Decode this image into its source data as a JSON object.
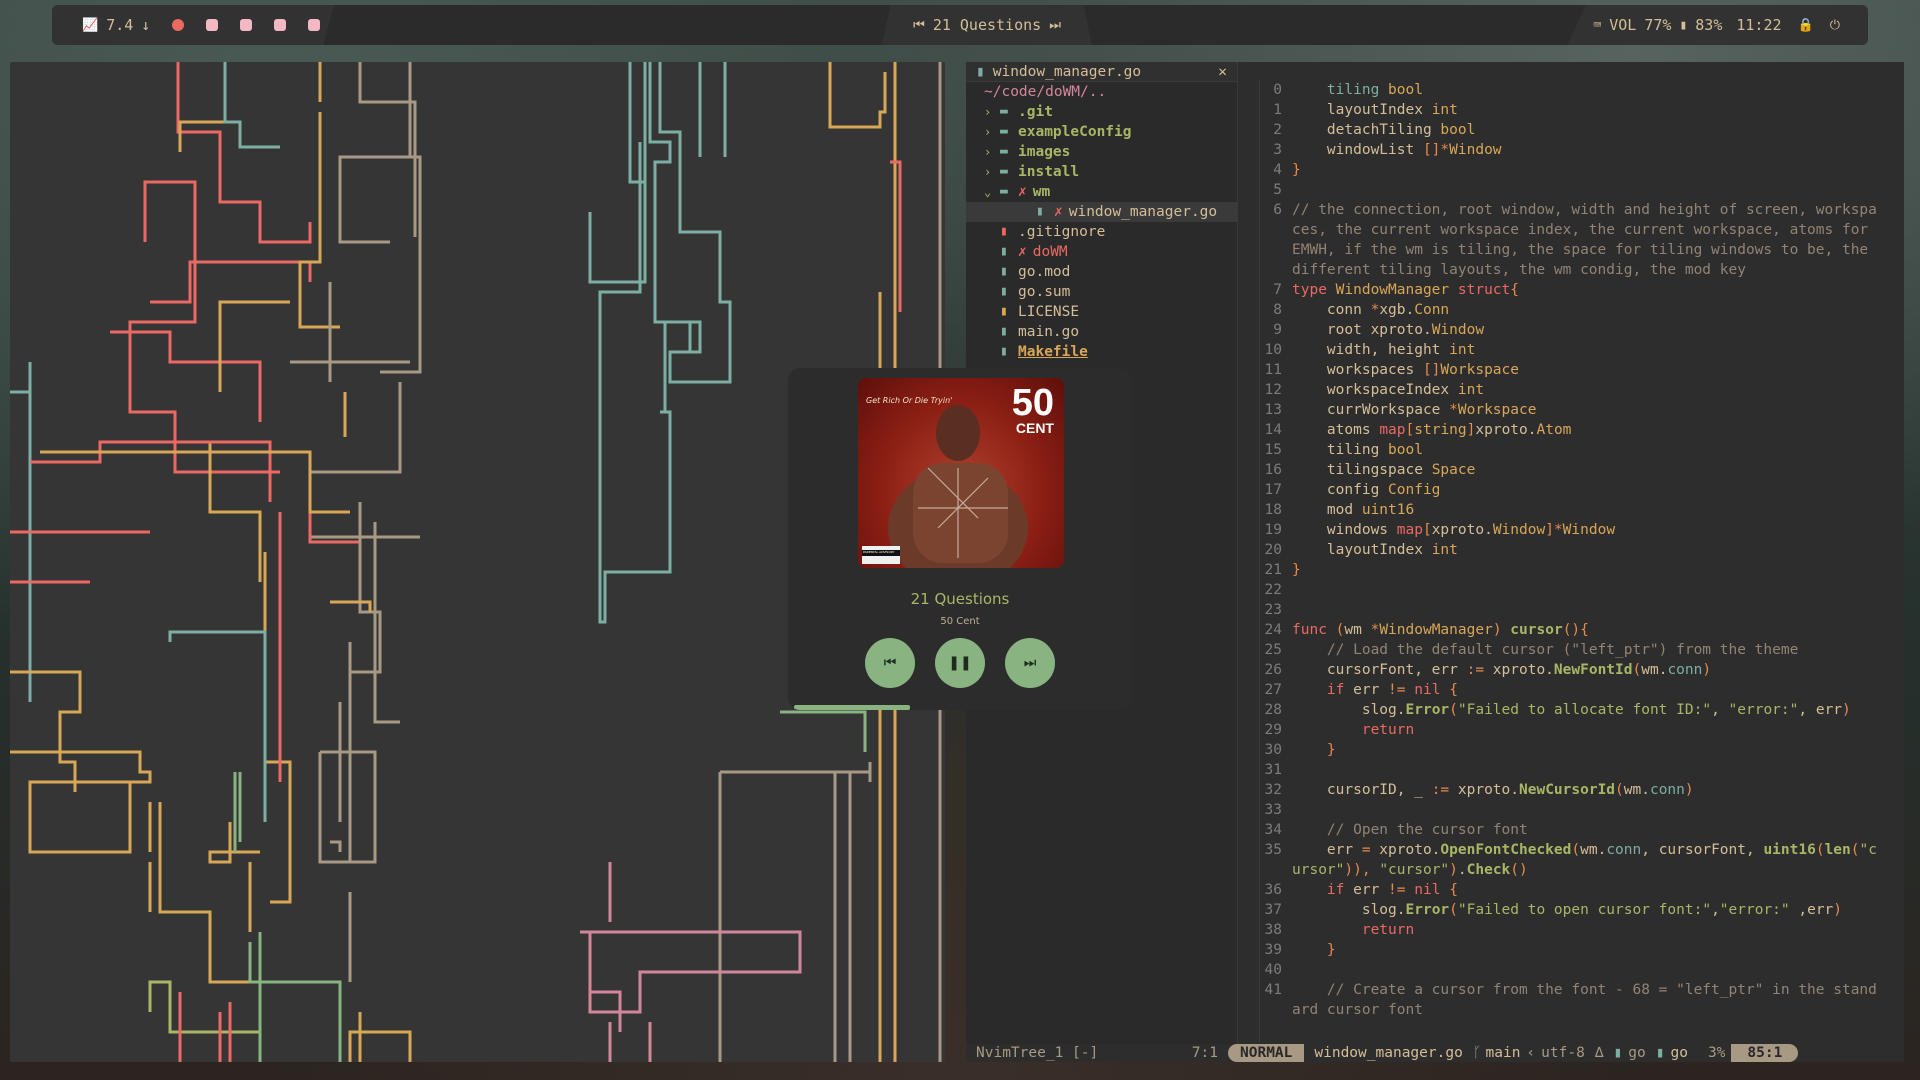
{
  "topbar": {
    "cpu_value": "7.4",
    "cpu_arrow": "↓",
    "track_label": "21 Questions",
    "vol_label": "VOL",
    "vol_value": "77%",
    "battery_value": "83%",
    "clock": "11:22",
    "workspace_count": 5
  },
  "nvim": {
    "tab": {
      "file": "window_manager.go",
      "close": "✕"
    },
    "tree": {
      "root": "~/code/doWM/..",
      "items": [
        {
          "name": ".git",
          "type": "dir",
          "arrow": "›",
          "marker": ""
        },
        {
          "name": "exampleConfig",
          "type": "dir",
          "arrow": "›",
          "marker": ""
        },
        {
          "name": "images",
          "type": "dir",
          "arrow": "›",
          "marker": ""
        },
        {
          "name": "install",
          "type": "dir",
          "arrow": "›",
          "marker": ""
        },
        {
          "name": "wm",
          "type": "dir",
          "arrow": "⌄",
          "marker": "✗"
        },
        {
          "name": "window_manager.go",
          "type": "file",
          "arrow": "",
          "marker": "✗",
          "indent": 1
        },
        {
          "name": ".gitignore",
          "type": "file",
          "arrow": "",
          "marker": ""
        },
        {
          "name": "doWM",
          "type": "file",
          "arrow": "",
          "marker": "✗"
        },
        {
          "name": "go.mod",
          "type": "file",
          "arrow": "",
          "marker": ""
        },
        {
          "name": "go.sum",
          "type": "file",
          "arrow": "",
          "marker": ""
        },
        {
          "name": "LICENSE",
          "type": "file",
          "arrow": "",
          "marker": ""
        },
        {
          "name": "main.go",
          "type": "file",
          "arrow": "",
          "marker": ""
        },
        {
          "name": "Makefile",
          "type": "file",
          "arrow": "",
          "marker": ""
        }
      ],
      "status_name": "NvimTree_1 [-]",
      "status_pos": "7:1"
    },
    "code_lines": [
      {
        "n": "0",
        "html": "    <span class='p'>tiling</span> <span class='t'>bool</span>"
      },
      {
        "n": "1",
        "html": "    layoutIndex <span class='t'>int</span>"
      },
      {
        "n": "2",
        "html": "    detachTiling <span class='t'>bool</span>"
      },
      {
        "n": "3",
        "html": "    windowList <span class='o'>[]*</span><span class='t'>Window</span>"
      },
      {
        "n": "4",
        "html": "<span class='o'>}</span>"
      },
      {
        "n": "5",
        "html": ""
      },
      {
        "n": "6",
        "html": "<span class='c'>// the connection, root window, width and height of screen, workspa</span>"
      },
      {
        "n": "",
        "html": "<span class='c'>ces, the current workspace index, the current workspace, atoms for</span>"
      },
      {
        "n": "",
        "html": "<span class='c'>EMWH, if the wm is tiling, the space for tiling windows to be, the</span>"
      },
      {
        "n": "",
        "html": "<span class='c'>different tiling layouts, the wm condig, the mod key</span>"
      },
      {
        "n": "7",
        "html": "<span class='k'>type</span> <span class='t'>WindowManager</span> <span class='k'>struct</span><span class='o'>{</span>"
      },
      {
        "n": "8",
        "html": "    conn <span class='o'>*</span>xgb.<span class='t'>Conn</span>"
      },
      {
        "n": "9",
        "html": "    root xproto.<span class='t'>Window</span>"
      },
      {
        "n": "10",
        "html": "    width, height <span class='t'>int</span>"
      },
      {
        "n": "11",
        "html": "    workspaces <span class='o'>[]</span><span class='t'>Workspace</span>"
      },
      {
        "n": "12",
        "html": "    workspaceIndex <span class='t'>int</span>"
      },
      {
        "n": "13",
        "html": "    currWorkspace <span class='o'>*</span><span class='t'>Workspace</span>"
      },
      {
        "n": "14",
        "html": "    atoms <span class='k'>map</span><span class='o'>[</span><span class='t'>string</span><span class='o'>]</span>xproto.<span class='t'>Atom</span>"
      },
      {
        "n": "15",
        "html": "    tiling <span class='t'>bool</span>"
      },
      {
        "n": "16",
        "html": "    tilingspace <span class='t'>Space</span>"
      },
      {
        "n": "17",
        "html": "    config <span class='t'>Config</span>"
      },
      {
        "n": "18",
        "html": "    mod <span class='t'>uint16</span>"
      },
      {
        "n": "19",
        "html": "    windows <span class='k'>map</span><span class='o'>[</span>xproto.<span class='t'>Window</span><span class='o'>]*</span><span class='t'>Window</span>"
      },
      {
        "n": "20",
        "html": "    layoutIndex <span class='t'>int</span>"
      },
      {
        "n": "21",
        "html": "<span class='o'>}</span>"
      },
      {
        "n": "22",
        "html": ""
      },
      {
        "n": "23",
        "html": ""
      },
      {
        "n": "24",
        "html": "<span class='k'>func</span> <span class='o'>(</span>wm <span class='o'>*</span><span class='t'>WindowManager</span><span class='o'>)</span> <span class='f'>cursor</span><span class='o'>(){</span>"
      },
      {
        "n": "25",
        "html": "    <span class='c'>// Load the default cursor (\"left_ptr\") from the theme</span>"
      },
      {
        "n": "26",
        "html": "    cursorFont, err <span class='o'>:=</span> xproto.<span class='f'>NewFontId</span><span class='o'>(</span>wm.<span class='p'>conn</span><span class='o'>)</span>"
      },
      {
        "n": "27",
        "html": "    <span class='k'>if</span> err <span class='o'>!=</span> <span class='k'>nil</span> <span class='o'>{</span>"
      },
      {
        "n": "28",
        "html": "        slog.<span class='f'>Error</span><span class='o'>(</span><span class='s'>\"Failed to allocate font ID:\"</span>, <span class='s'>\"error:\"</span>, err<span class='o'>)</span>"
      },
      {
        "n": "29",
        "html": "        <span class='k'>return</span>"
      },
      {
        "n": "30",
        "html": "    <span class='o'>}</span>"
      },
      {
        "n": "31",
        "html": ""
      },
      {
        "n": "32",
        "html": "    cursorID, _ <span class='o'>:=</span> xproto.<span class='f'>NewCursorId</span><span class='o'>(</span>wm.<span class='p'>conn</span><span class='o'>)</span>"
      },
      {
        "n": "33",
        "html": ""
      },
      {
        "n": "34",
        "html": "    <span class='c'>// Open the cursor font</span>"
      },
      {
        "n": "35",
        "html": "    err <span class='o'>=</span> xproto.<span class='f'>OpenFontChecked</span><span class='o'>(</span>wm.<span class='p'>conn</span>, cursorFont, <span class='f'>uint16</span><span class='o'>(</span><span class='f'>len</span><span class='o'>(</span><span class='s'>\"c</span>"
      },
      {
        "n": "",
        "html": "<span class='s'>ursor\"</span><span class='o'>)),</span> <span class='s'>\"cursor\"</span><span class='o'>)</span>.<span class='f'>Check</span><span class='o'>()</span>"
      },
      {
        "n": "36",
        "html": "    <span class='k'>if</span> err <span class='o'>!=</span> <span class='k'>nil</span> <span class='o'>{</span>"
      },
      {
        "n": "37",
        "html": "        slog.<span class='f'>Error</span><span class='o'>(</span><span class='s'>\"Failed to open cursor font:\"</span>,<span class='s'>\"error:\"</span> ,err<span class='o'>)</span>"
      },
      {
        "n": "38",
        "html": "        <span class='k'>return</span>"
      },
      {
        "n": "39",
        "html": "    <span class='o'>}</span>"
      },
      {
        "n": "40",
        "html": ""
      },
      {
        "n": "41",
        "html": "    <span class='c'>// Create a cursor from the font - 68 = \"left_ptr\" in the stand</span>"
      },
      {
        "n": "",
        "html": "<span class='c'>ard cursor font</span>"
      }
    ],
    "status": {
      "mode": "NORMAL",
      "file": "window_manager.go",
      "branch": "main",
      "encoding": "utf-8",
      "filetype": "go",
      "filetype2": "go",
      "percent": "3%",
      "position": "85:1"
    }
  },
  "player": {
    "title": "21 Questions",
    "artist": "50 Cent",
    "album_text_top": "Get Rich Or Die Tryin'",
    "album_text_logo": "50",
    "album_text_logo2": "CENT",
    "album_text_advisory": "PARENTAL ADVISORY",
    "progress": 0.35
  },
  "colors": {
    "accent_green": "#89b482",
    "accent_yellow": "#d8a657",
    "accent_red": "#ea6962",
    "bar_bg": "#2b2b2b"
  }
}
